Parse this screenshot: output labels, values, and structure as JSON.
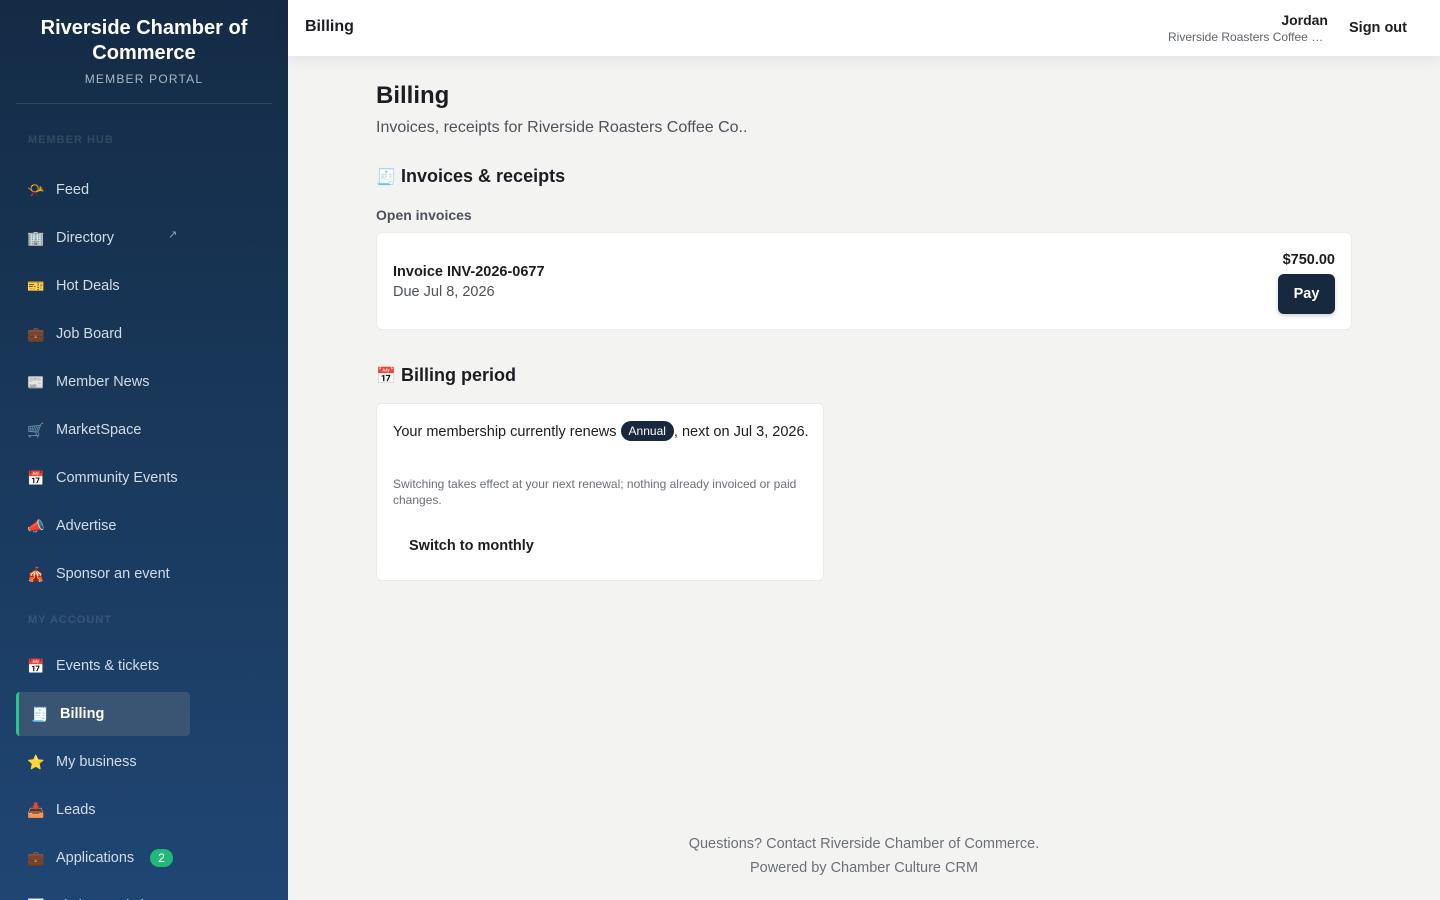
{
  "sidebar": {
    "brand_name": "Riverside Chamber of Commerce",
    "brand_sub": "MEMBER PORTAL",
    "section_1": "MEMBER HUB",
    "items_top": [
      {
        "label": "Feed",
        "icon": "📯",
        "icon_name": "horn-icon"
      },
      {
        "label": "Directory",
        "icon": "🏢",
        "icon_name": "building-icon",
        "external": "↗"
      },
      {
        "label": "Hot Deals",
        "icon": "🎫",
        "icon_name": "ticket-icon"
      },
      {
        "label": "Job Board",
        "icon": "💼",
        "icon_name": "briefcase-icon"
      },
      {
        "label": "Member News",
        "icon": "📰",
        "icon_name": "newspaper-icon"
      },
      {
        "label": "MarketSpace",
        "icon": "🛒",
        "icon_name": "cart-icon"
      },
      {
        "label": "Community Events",
        "icon": "📅",
        "icon_name": "calendar-icon"
      },
      {
        "label": "Advertise",
        "icon": "📣",
        "icon_name": "megaphone-icon"
      },
      {
        "label": "Sponsor an event",
        "icon": "🎪",
        "icon_name": "tent-icon"
      }
    ],
    "section_2": "MY ACCOUNT",
    "items_bottom": [
      {
        "label": "Events & tickets",
        "icon": "📅",
        "icon_name": "calendar-icon"
      },
      {
        "label": "Billing",
        "icon": "🧾",
        "icon_name": "receipt-icon",
        "active": true
      },
      {
        "label": "My business",
        "icon": "⭐",
        "icon_name": "star-icon"
      },
      {
        "label": "Leads",
        "icon": "📥",
        "icon_name": "inbox-icon"
      },
      {
        "label": "Applications",
        "icon": "💼",
        "icon_name": "briefcase-icon",
        "badge": "2"
      },
      {
        "label": "Listing analytics",
        "icon": "📊",
        "icon_name": "chart-icon"
      }
    ]
  },
  "header": {
    "title": "Billing",
    "user_name": "Jordan",
    "user_org": "Riverside Roasters Coffee Co.",
    "sign_out": "Sign out"
  },
  "main": {
    "title": "Billing",
    "subtitle": "Invoices, receipts for Riverside Roasters Coffee Co..",
    "invoices_section": {
      "icon": "🧾",
      "heading": "Invoices & receipts",
      "subheading": "Open invoices",
      "invoice": {
        "title": "Invoice INV-2026-0677",
        "due": "Due Jul 8, 2026",
        "amount": "$750.00",
        "pay_label": "Pay"
      }
    },
    "period_section": {
      "icon": "📅",
      "heading": "Billing period",
      "renew_prefix": "Your membership currently renews",
      "renew_badge": "Annual",
      "renew_suffix": ", next on Jul 3, 2026.",
      "note": "Switching takes effect at your next renewal; nothing already invoiced or paid changes.",
      "switch_label": "Switch to monthly"
    }
  },
  "footer": {
    "line1": "Questions? Contact Riverside Chamber of Commerce.",
    "line2": "Powered by Chamber Culture CRM"
  },
  "colors": {
    "sidebar_top": "#142b45",
    "sidebar_bottom": "#1f4673",
    "accent_green": "#2fc58a",
    "primary_dark": "#17283f",
    "page_bg": "#f3f3f1"
  }
}
